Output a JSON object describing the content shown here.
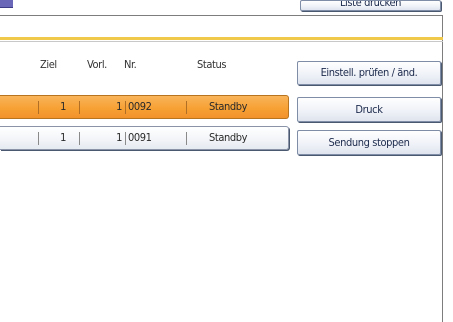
{
  "top": {
    "print_list_label": "Liste drucken"
  },
  "table": {
    "headers": {
      "dest": "Ziel",
      "pages": "Vorl.",
      "number": "Nr.",
      "status": "Status"
    },
    "rows": [
      {
        "dest": "1",
        "pages": "1",
        "number": "0092",
        "status": "Standby",
        "selected": true
      },
      {
        "dest": "1",
        "pages": "1",
        "number": "0091",
        "status": "Standby",
        "selected": false
      }
    ]
  },
  "actions": {
    "check_label": "Einstell. prüfen / änd.",
    "print_label": "Druck",
    "stop_label": "Sendung stoppen"
  },
  "colors": {
    "selected_row": "#f7a135",
    "accent_separator": "#f0c84a",
    "button_text": "#1c2a4c"
  }
}
